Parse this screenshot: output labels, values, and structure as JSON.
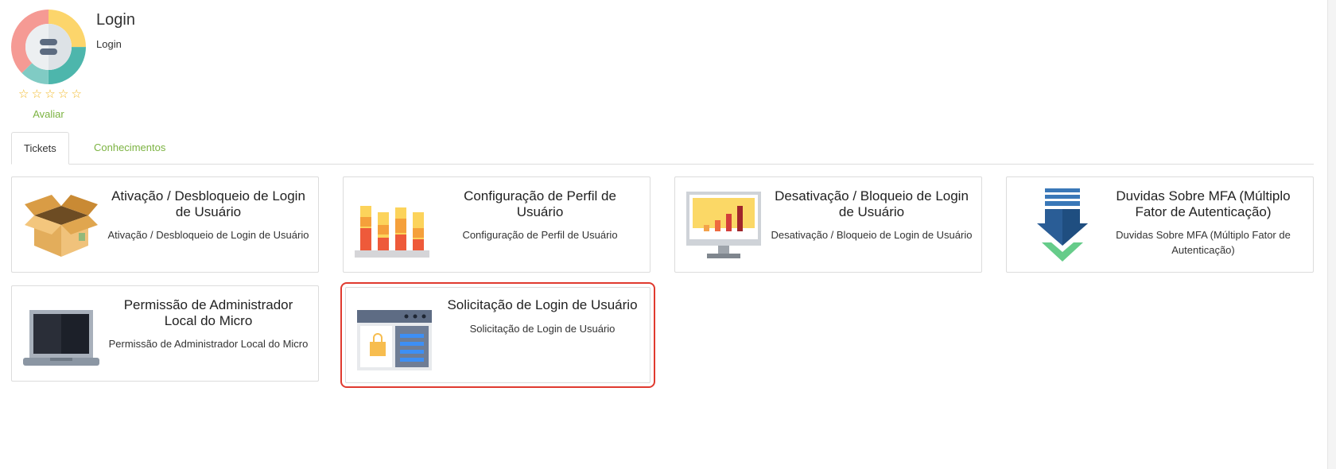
{
  "header": {
    "title": "Login",
    "subtitle": "Login",
    "stars": [
      "☆",
      "☆",
      "☆",
      "☆",
      "☆"
    ],
    "rate_label": "Avaliar",
    "logo_icon": "service-catalog-logo-icon"
  },
  "tabs": [
    {
      "label": "Tickets",
      "active": true
    },
    {
      "label": "Conhecimentos",
      "active": false
    }
  ],
  "cards": [
    {
      "title": "Ativação / Desbloqueio de Login de Usuário",
      "description": "Ativação / Desbloqueio de Login de Usuário",
      "icon": "open-box-icon"
    },
    {
      "title": "Configuração de Perfil de Usuário",
      "description": "Configuração de Perfil de Usuário",
      "icon": "bar-chart-icon"
    },
    {
      "title": "Desativação / Bloqueio de Login de Usuário",
      "description": "Desativação / Bloqueio de Login de Usuário",
      "icon": "monitor-chart-icon"
    },
    {
      "title": "Duvidas Sobre MFA (Múltiplo Fator de Autenticação)",
      "description": "Duvidas Sobre MFA (Múltiplo Fator de Autenticação)",
      "icon": "download-arrow-icon"
    },
    {
      "title": "Permissão de Administrador Local do Micro",
      "description": "Permissão de Administrador Local do Micro",
      "icon": "laptop-icon"
    },
    {
      "title": "Solicitação de Login de Usuário",
      "description": "Solicitação de Login de Usuário",
      "icon": "browser-window-icon",
      "selected": true
    }
  ],
  "colors": {
    "accent_green": "#7cb342",
    "star_yellow": "#f2b824",
    "selection_red": "#e03a2f"
  }
}
